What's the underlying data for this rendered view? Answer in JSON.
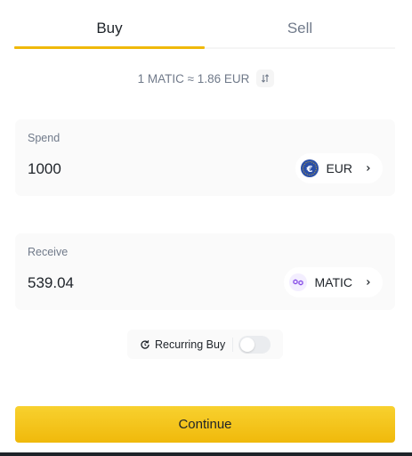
{
  "tabs": [
    {
      "label": "Buy",
      "active": true
    },
    {
      "label": "Sell",
      "active": false
    }
  ],
  "rate": {
    "text": "1 MATIC ≈ 1.86 EUR"
  },
  "spend": {
    "label": "Spend",
    "value": "1000",
    "asset": {
      "symbol": "EUR",
      "icon": "euro-icon",
      "color": "#2a4fa8"
    }
  },
  "receive": {
    "label": "Receive",
    "value": "539.04",
    "asset": {
      "symbol": "MATIC",
      "icon": "polygon-matic-icon",
      "color": "#8247e5"
    }
  },
  "recurring": {
    "label": "Recurring Buy",
    "enabled": false
  },
  "continue_label": "Continue",
  "colors": {
    "accent": "#f0b90b",
    "text": "#1e2329",
    "muted": "#707a8a"
  }
}
